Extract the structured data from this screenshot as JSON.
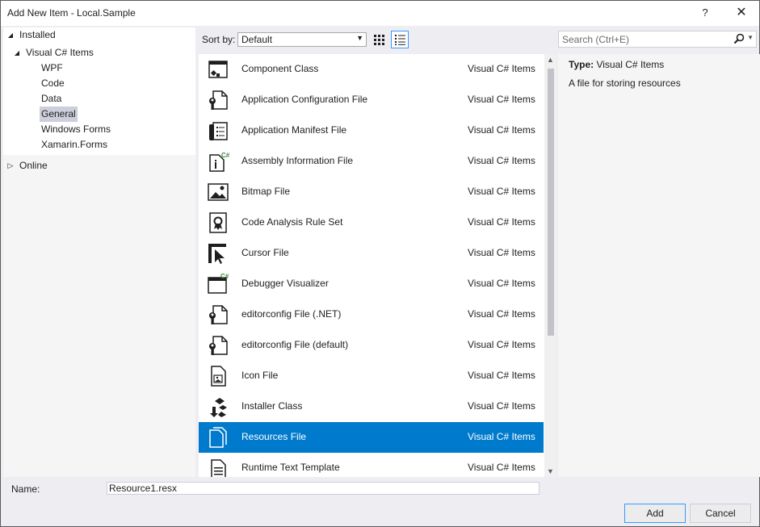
{
  "window": {
    "title": "Add New Item - Local.Sample",
    "help_label": "?",
    "close_label": "✕"
  },
  "sidebar": {
    "installed_label": "Installed",
    "visual_csharp_label": "Visual C# Items",
    "children": [
      "WPF",
      "Code",
      "Data",
      "General",
      "Windows Forms",
      "Xamarin.Forms"
    ],
    "selected_child": "General",
    "online_label": "Online"
  },
  "toolbar": {
    "sort_label": "Sort by:",
    "sort_value": "Default"
  },
  "search": {
    "placeholder": "Search (Ctrl+E)"
  },
  "items": [
    {
      "name": "Component Class",
      "category": "Visual C# Items",
      "icon": "component-class-icon"
    },
    {
      "name": "Application Configuration File",
      "category": "Visual C# Items",
      "icon": "config-file-icon"
    },
    {
      "name": "Application Manifest File",
      "category": "Visual C# Items",
      "icon": "manifest-file-icon"
    },
    {
      "name": "Assembly Information File",
      "category": "Visual C# Items",
      "icon": "assembly-info-icon"
    },
    {
      "name": "Bitmap File",
      "category": "Visual C# Items",
      "icon": "bitmap-icon"
    },
    {
      "name": "Code Analysis Rule Set",
      "category": "Visual C# Items",
      "icon": "rule-set-icon"
    },
    {
      "name": "Cursor File",
      "category": "Visual C# Items",
      "icon": "cursor-icon"
    },
    {
      "name": "Debugger Visualizer",
      "category": "Visual C# Items",
      "icon": "debugger-visualizer-icon"
    },
    {
      "name": "editorconfig File (.NET)",
      "category": "Visual C# Items",
      "icon": "editorconfig-icon"
    },
    {
      "name": "editorconfig File (default)",
      "category": "Visual C# Items",
      "icon": "editorconfig-icon"
    },
    {
      "name": "Icon File",
      "category": "Visual C# Items",
      "icon": "icon-file-icon"
    },
    {
      "name": "Installer Class",
      "category": "Visual C# Items",
      "icon": "installer-icon"
    },
    {
      "name": "Resources File",
      "category": "Visual C# Items",
      "icon": "resources-file-icon",
      "selected": true
    },
    {
      "name": "Runtime Text Template",
      "category": "Visual C# Items",
      "icon": "text-template-icon"
    }
  ],
  "details": {
    "type_label": "Type:",
    "type_value": "Visual C# Items",
    "description": "A file for storing resources"
  },
  "form": {
    "name_label": "Name:",
    "name_value": "Resource1.resx",
    "add_label": "Add",
    "cancel_label": "Cancel"
  },
  "colors": {
    "selection": "#007acc",
    "tree_selection": "#cccedb",
    "accent": "#3399ff"
  }
}
